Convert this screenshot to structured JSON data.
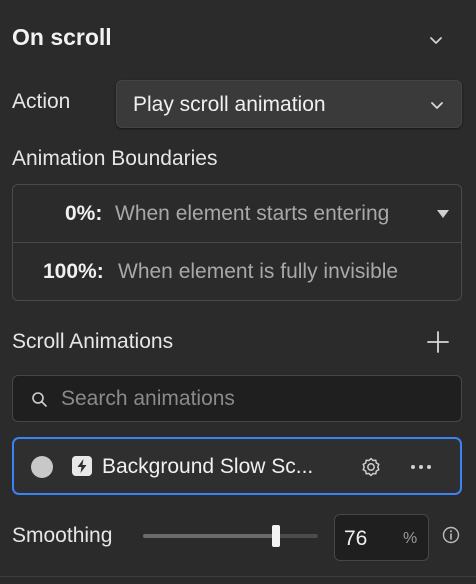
{
  "section": {
    "title": "On scroll"
  },
  "action": {
    "label": "Action",
    "selected": "Play scroll animation"
  },
  "boundaries": {
    "label": "Animation Boundaries",
    "rows": [
      {
        "percent": "0%:",
        "description": "When element starts entering"
      },
      {
        "percent": "100%:",
        "description": "When element is fully invisible"
      }
    ]
  },
  "scroll_animations": {
    "label": "Scroll Animations",
    "search_placeholder": "Search animations",
    "items": [
      {
        "name": "Background Slow Sc..."
      }
    ]
  },
  "smoothing": {
    "label": "Smoothing",
    "value": "76",
    "unit": "%",
    "level_fraction": 0.76
  },
  "colors": {
    "accent": "#3b82f6",
    "background": "#2b2b2b"
  }
}
